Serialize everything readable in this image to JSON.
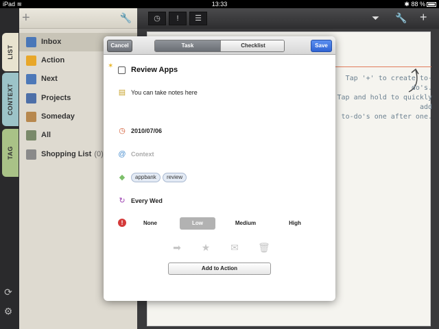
{
  "status_bar": {
    "carrier": "iPad",
    "time": "13:33",
    "battery": "88 %"
  },
  "side_tabs": [
    {
      "label": "LIST"
    },
    {
      "label": "CONTEXT"
    },
    {
      "label": "TAG"
    }
  ],
  "sidebar": {
    "items": [
      {
        "label": "Inbox",
        "count": "",
        "icon": "inbox-icon",
        "color": "#4a77b8"
      },
      {
        "label": "Action",
        "count": "",
        "icon": "action-icon",
        "color": "#e8a72a"
      },
      {
        "label": "Next",
        "count": "",
        "icon": "next-icon",
        "color": "#4d78b8"
      },
      {
        "label": "Projects",
        "count": "",
        "icon": "projects-icon",
        "color": "#4d6fa8"
      },
      {
        "label": "Someday",
        "count": "",
        "icon": "someday-icon",
        "color": "#b7884e"
      },
      {
        "label": "All",
        "count": "",
        "icon": "all-icon",
        "color": "#7a8a6a"
      },
      {
        "label": "Shopping List",
        "count": "(0)",
        "icon": "shopping-list-icon",
        "color": "#8a8a8a"
      }
    ]
  },
  "hint": {
    "line1": "Tap '+' to create to-do's.",
    "line2": "Tap and hold to quickly add",
    "line3": "to-do's one after one."
  },
  "modal": {
    "cancel_label": "Cancel",
    "save_label": "Save",
    "tab_task": "Task",
    "tab_checklist": "Checklist",
    "title": "Review Apps",
    "notes": "You can take notes here",
    "date": "2010/07/06",
    "context_placeholder": "Context",
    "tags": [
      "appbank",
      "review"
    ],
    "repeat": "Every Wed",
    "priorities": [
      "None",
      "Low",
      "Medium",
      "High"
    ],
    "selected_priority": "Low",
    "add_button": "Add to Action"
  },
  "colors": {
    "accent_blue": "#2f63d3",
    "red_line": "#e07a5a"
  }
}
